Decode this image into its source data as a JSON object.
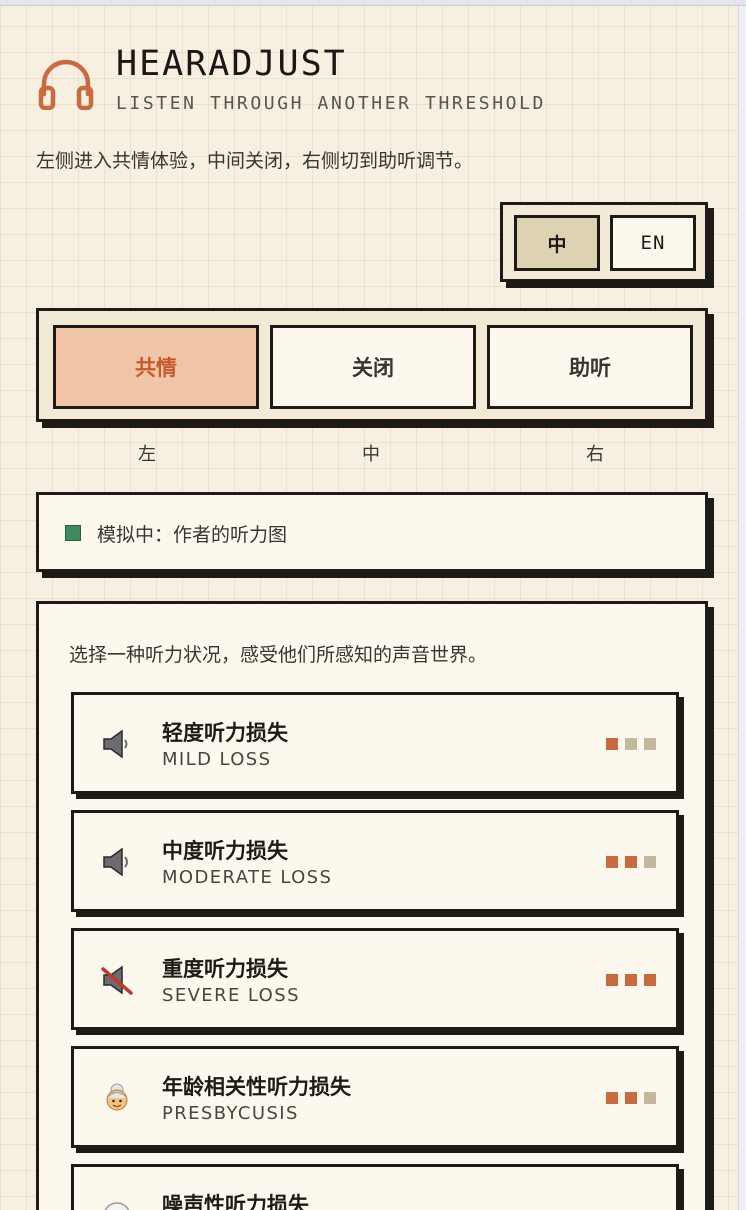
{
  "app": {
    "title": "HEARADJUST",
    "subtitle": "LISTEN THROUGH ANOTHER THRESHOLD",
    "intro": "左侧进入共情体验，中间关闭，右侧切到助听调节。",
    "logo_icon": "headphones-icon",
    "accent_color": "#c96a3f"
  },
  "language": {
    "zh_label": "中",
    "en_label": "EN",
    "selected": "中"
  },
  "modes": {
    "selected": "共情",
    "items": [
      {
        "label": "共情",
        "hint": "左"
      },
      {
        "label": "关闭",
        "hint": "中"
      },
      {
        "label": "助听",
        "hint": "右"
      }
    ]
  },
  "status": {
    "text": "模拟中：作者的听力图",
    "dot_color": "#3d8a5c"
  },
  "conditions": {
    "intro": "选择一种听力状况，感受他们所感知的声音世界。",
    "items": [
      {
        "name": "轻度听力损失",
        "name_en": "MILD LOSS",
        "icon": "speaker-low-icon",
        "severity": 1
      },
      {
        "name": "中度听力损失",
        "name_en": "MODERATE LOSS",
        "icon": "speaker-medium-icon",
        "severity": 2
      },
      {
        "name": "重度听力损失",
        "name_en": "SEVERE LOSS",
        "icon": "speaker-muted-icon",
        "severity": 3
      },
      {
        "name": "年龄相关性听力损失",
        "name_en": "PRESBYCUSIS",
        "icon": "older-woman-icon",
        "severity": 2
      },
      {
        "name": "噪声性听力损失",
        "name_en": "",
        "icon": "noise-icon",
        "severity": 0
      }
    ]
  }
}
